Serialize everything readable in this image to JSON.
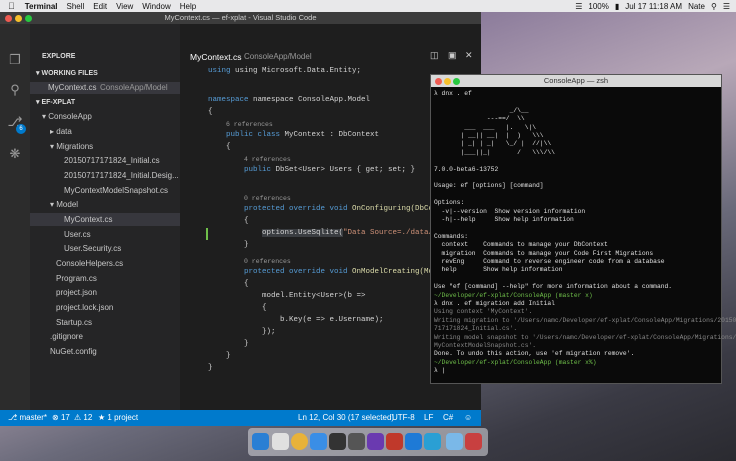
{
  "menubar": {
    "app_name": "Terminal",
    "menus": [
      "Shell",
      "Edit",
      "View",
      "Window",
      "Help"
    ],
    "battery": "100%",
    "datetime": "Jul 17  11:18 AM",
    "user": "Nate"
  },
  "vscode": {
    "window_title": "MyContext.cs — ef-xplat - Visual Studio Code",
    "explore_label": "EXPLORE",
    "working_files_label": "WORKING FILES",
    "working_file_name": "MyContext.cs",
    "working_file_path": "ConsoleApp/Model",
    "project_label": "EF-XPLAT",
    "tree": {
      "consoleapp": "ConsoleApp",
      "data": "data",
      "migrations": "Migrations",
      "mig1": "20150717171824_Initial.cs",
      "mig2": "20150717171824_Initial.Desig...",
      "mig3": "MyContextModelSnapshot.cs",
      "model": "Model",
      "mycontext": "MyContext.cs",
      "user": "User.cs",
      "usersec": "User.Security.cs",
      "consolehelpers": "ConsoleHelpers.cs",
      "program": "Program.cs",
      "projectjson": "project.json",
      "projectlock": "project.lock.json",
      "startup": "Startup.cs",
      "gitignore": ".gitignore",
      "nuget": "NuGet.config"
    },
    "editor_tab": "MyContext.cs",
    "editor_tab_path": "ConsoleApp/Model",
    "code": {
      "l1": "using Microsoft.Data.Entity;",
      "l2": "namespace ConsoleApp.Model",
      "l3": "{",
      "r1": "6 references",
      "l4a": "public class",
      "l4b": "MyContext : DbContext",
      "l5": "{",
      "r2": "4 references",
      "l6a": "public",
      "l6b": "DbSet<User> Users { get; set; }",
      "r3": "0 references",
      "l7a": "protected override void",
      "l7b": "OnConfiguring(DbCont",
      "l8": "{",
      "l9a": "options.UseSqlite(",
      "l9b": "\"Data Source=./data/da",
      "l10": "}",
      "r4": "0 references",
      "l11a": "protected override void",
      "l11b": "OnModelCreating(Mode",
      "l12": "{",
      "l13": "model.Entity<User>(b =>",
      "l14": "{",
      "l15": "b.Key(e => e.Username);",
      "l16": "});",
      "l17": "}",
      "l18": "}",
      "l19": "}"
    },
    "status": {
      "branch": "master*",
      "errors": "17",
      "warnings": "12",
      "projects": "1 project",
      "position": "Ln 12, Col 30 (17 selected)",
      "encoding": "UTF-8",
      "eol": "LF",
      "language": "C#"
    },
    "badge_count": "6"
  },
  "terminal": {
    "title": "ConsoleApp — zsh",
    "lines": [
      "λ dnx . ef",
      "",
      "                    _/\\__",
      "              ---==/  \\\\",
      "        ___  ___   |.   \\|\\",
      "       | __|| __|  |  )   \\\\\\",
      "       | _| | _|   \\_/ |  //|\\\\",
      "       |___||_|       /   \\\\\\/\\\\",
      "",
      "7.0.0-beta6-13752",
      "",
      "Usage: ef [options] [command]",
      "",
      "Options:",
      "  -v|--version  Show version information",
      "  -h|--help     Show help information",
      "",
      "Commands:",
      "  context    Commands to manage your DbContext",
      "  migration  Commands to manage your Code First Migrations",
      "  revEng     Command to reverse engineer code from a database",
      "  help       Show help information",
      "",
      "Use \"ef [command] --help\" for more information about a command.",
      "~/Developer/ef-xplat/ConsoleApp (master x)",
      "λ dnx . ef migration add Initial",
      "Using context 'MyContext'.",
      "Writing migration to '/Users/namc/Developer/ef-xplat/ConsoleApp/Migrations/20150",
      "717171824_Initial.cs'.",
      "Writing model snapshot to '/Users/namc/Developer/ef-xplat/ConsoleApp/Migrations/",
      "MyContextModelSnapshot.cs'.",
      "Done. To undo this action, use 'ef migration remove'.",
      "~/Developer/ef-xplat/ConsoleApp (master x%)",
      "λ |"
    ]
  }
}
